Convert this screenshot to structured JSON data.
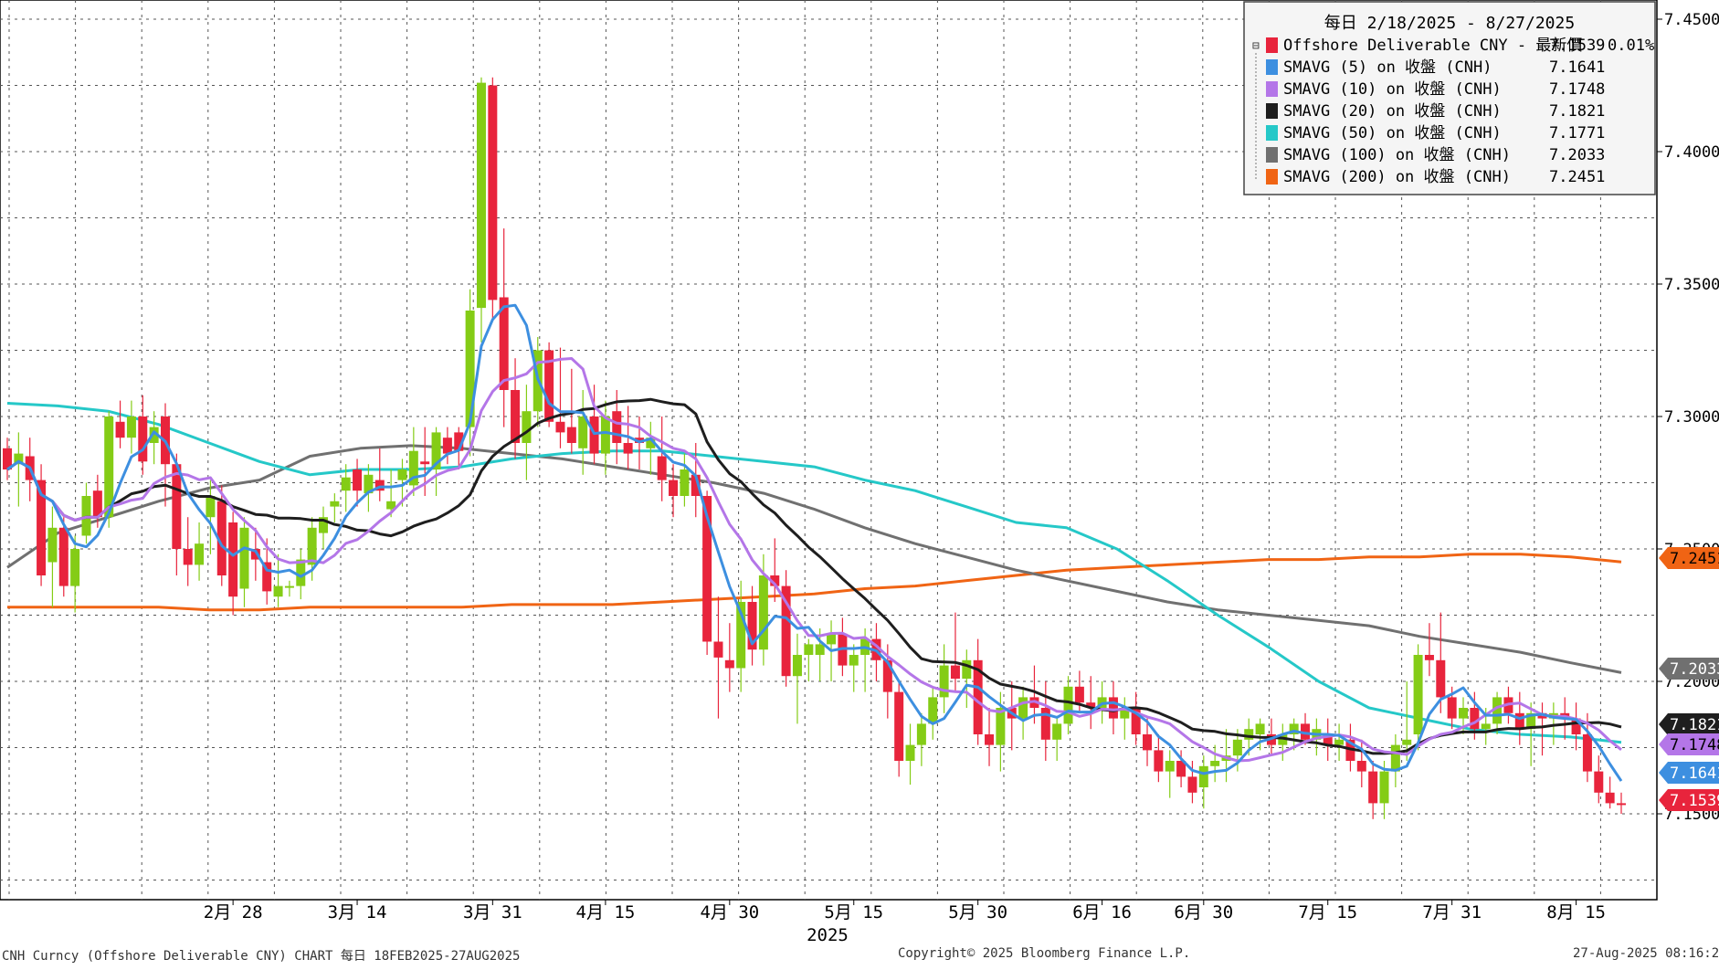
{
  "chart_data": {
    "type": "candlestick",
    "instrument": "CNH Curncy",
    "period_header": "每日 2/18/2025 - 8/27/2025",
    "ylim": [
      7.12,
      7.455
    ],
    "y_ticks": [
      "7.4500",
      "7.4000",
      "7.3500",
      "7.3000",
      "7.2500",
      "7.2000",
      "7.1500"
    ],
    "y_tick_values": [
      7.45,
      7.4,
      7.35,
      7.3,
      7.25,
      7.2,
      7.15
    ],
    "x_tick_labels": [
      "2月 28",
      "3月 14",
      "3月 31",
      "4月 15",
      "4月 30",
      "5月 15",
      "5月 30",
      "6月 16",
      "6月 30",
      "7月 15",
      "7月 31",
      "8月 15"
    ],
    "x_tick_index": [
      20,
      31,
      43,
      53,
      64,
      75,
      86,
      97,
      106,
      117,
      128,
      139
    ],
    "x_year_label": "2025",
    "grid": true,
    "legend_placement": "top-right",
    "ohlc": [
      [
        7.288,
        7.292,
        7.276,
        7.28
      ],
      [
        7.282,
        7.294,
        7.266,
        7.286
      ],
      [
        7.285,
        7.292,
        7.268,
        7.276
      ],
      [
        7.276,
        7.282,
        7.236,
        7.24
      ],
      [
        7.245,
        7.266,
        7.228,
        7.258
      ],
      [
        7.258,
        7.262,
        7.232,
        7.236
      ],
      [
        7.236,
        7.255,
        7.226,
        7.25
      ],
      [
        7.255,
        7.275,
        7.252,
        7.27
      ],
      [
        7.272,
        7.278,
        7.258,
        7.262
      ],
      [
        7.262,
        7.302,
        7.258,
        7.3
      ],
      [
        7.298,
        7.306,
        7.288,
        7.292
      ],
      [
        7.292,
        7.306,
        7.286,
        7.3
      ],
      [
        7.3,
        7.308,
        7.278,
        7.283
      ],
      [
        7.29,
        7.302,
        7.282,
        7.296
      ],
      [
        7.3,
        7.305,
        7.266,
        7.282
      ],
      [
        7.282,
        7.286,
        7.24,
        7.25
      ],
      [
        7.25,
        7.262,
        7.236,
        7.244
      ],
      [
        7.244,
        7.26,
        7.238,
        7.252
      ],
      [
        7.262,
        7.276,
        7.248,
        7.27
      ],
      [
        7.268,
        7.274,
        7.236,
        7.24
      ],
      [
        7.26,
        7.264,
        7.225,
        7.232
      ],
      [
        7.235,
        7.262,
        7.228,
        7.258
      ],
      [
        7.25,
        7.258,
        7.238,
        7.246
      ],
      [
        7.245,
        7.254,
        7.229,
        7.234
      ],
      [
        7.232,
        7.248,
        7.228,
        7.236
      ],
      [
        7.236,
        7.238,
        7.232,
        7.236
      ],
      [
        7.236,
        7.25,
        7.231,
        7.246
      ],
      [
        7.244,
        7.262,
        7.238,
        7.258
      ],
      [
        7.256,
        7.266,
        7.25,
        7.262
      ],
      [
        7.266,
        7.271,
        7.26,
        7.268
      ],
      [
        7.272,
        7.282,
        7.264,
        7.277
      ],
      [
        7.28,
        7.284,
        7.266,
        7.272
      ],
      [
        7.271,
        7.282,
        7.264,
        7.278
      ],
      [
        7.276,
        7.288,
        7.268,
        7.272
      ],
      [
        7.265,
        7.28,
        7.262,
        7.268
      ],
      [
        7.276,
        7.284,
        7.266,
        7.28
      ],
      [
        7.274,
        7.296,
        7.27,
        7.287
      ],
      [
        7.283,
        7.296,
        7.27,
        7.282
      ],
      [
        7.28,
        7.296,
        7.27,
        7.294
      ],
      [
        7.292,
        7.296,
        7.282,
        7.286
      ],
      [
        7.294,
        7.296,
        7.28,
        7.287
      ],
      [
        7.296,
        7.348,
        7.285,
        7.34
      ],
      [
        7.341,
        7.428,
        7.328,
        7.426
      ],
      [
        7.425,
        7.428,
        7.336,
        7.344
      ],
      [
        7.345,
        7.371,
        7.296,
        7.31
      ],
      [
        7.31,
        7.322,
        7.284,
        7.29
      ],
      [
        7.29,
        7.312,
        7.276,
        7.302
      ],
      [
        7.302,
        7.33,
        7.296,
        7.325
      ],
      [
        7.325,
        7.328,
        7.296,
        7.298
      ],
      [
        7.298,
        7.326,
        7.288,
        7.294
      ],
      [
        7.296,
        7.318,
        7.286,
        7.29
      ],
      [
        7.288,
        7.31,
        7.278,
        7.3
      ],
      [
        7.3,
        7.312,
        7.282,
        7.286
      ],
      [
        7.286,
        7.306,
        7.278,
        7.3
      ],
      [
        7.302,
        7.31,
        7.282,
        7.29
      ],
      [
        7.29,
        7.304,
        7.28,
        7.286
      ],
      [
        7.292,
        7.3,
        7.28,
        7.29
      ],
      [
        7.288,
        7.298,
        7.278,
        7.292
      ],
      [
        7.285,
        7.3,
        7.268,
        7.276
      ],
      [
        7.276,
        7.282,
        7.262,
        7.27
      ],
      [
        7.27,
        7.286,
        7.266,
        7.28
      ],
      [
        7.278,
        7.29,
        7.262,
        7.27
      ],
      [
        7.27,
        7.272,
        7.21,
        7.215
      ],
      [
        7.215,
        7.232,
        7.186,
        7.209
      ],
      [
        7.208,
        7.222,
        7.196,
        7.205
      ],
      [
        7.205,
        7.238,
        7.196,
        7.23
      ],
      [
        7.23,
        7.236,
        7.206,
        7.212
      ],
      [
        7.212,
        7.248,
        7.206,
        7.24
      ],
      [
        7.24,
        7.254,
        7.23,
        7.236
      ],
      [
        7.236,
        7.242,
        7.198,
        7.202
      ],
      [
        7.202,
        7.218,
        7.184,
        7.21
      ],
      [
        7.21,
        7.216,
        7.2,
        7.214
      ],
      [
        7.21,
        7.22,
        7.2,
        7.214
      ],
      [
        7.214,
        7.223,
        7.2,
        7.218
      ],
      [
        7.218,
        7.224,
        7.202,
        7.206
      ],
      [
        7.206,
        7.214,
        7.196,
        7.21
      ],
      [
        7.21,
        7.22,
        7.196,
        7.216
      ],
      [
        7.216,
        7.222,
        7.2,
        7.208
      ],
      [
        7.208,
        7.214,
        7.186,
        7.196
      ],
      [
        7.196,
        7.2,
        7.164,
        7.17
      ],
      [
        7.17,
        7.184,
        7.161,
        7.176
      ],
      [
        7.176,
        7.188,
        7.168,
        7.184
      ],
      [
        7.184,
        7.198,
        7.178,
        7.194
      ],
      [
        7.194,
        7.214,
        7.188,
        7.206
      ],
      [
        7.206,
        7.226,
        7.196,
        7.201
      ],
      [
        7.201,
        7.212,
        7.19,
        7.208
      ],
      [
        7.208,
        7.216,
        7.176,
        7.18
      ],
      [
        7.18,
        7.19,
        7.168,
        7.176
      ],
      [
        7.176,
        7.196,
        7.166,
        7.19
      ],
      [
        7.19,
        7.2,
        7.174,
        7.186
      ],
      [
        7.186,
        7.198,
        7.178,
        7.194
      ],
      [
        7.194,
        7.206,
        7.184,
        7.19
      ],
      [
        7.19,
        7.2,
        7.17,
        7.178
      ],
      [
        7.178,
        7.186,
        7.17,
        7.184
      ],
      [
        7.184,
        7.202,
        7.18,
        7.198
      ],
      [
        7.198,
        7.204,
        7.188,
        7.192
      ],
      [
        7.192,
        7.202,
        7.182,
        7.19
      ],
      [
        7.19,
        7.2,
        7.184,
        7.194
      ],
      [
        7.194,
        7.2,
        7.18,
        7.186
      ],
      [
        7.186,
        7.194,
        7.178,
        7.19
      ],
      [
        7.19,
        7.196,
        7.176,
        7.18
      ],
      [
        7.18,
        7.186,
        7.168,
        7.174
      ],
      [
        7.174,
        7.18,
        7.162,
        7.166
      ],
      [
        7.166,
        7.174,
        7.156,
        7.17
      ],
      [
        7.17,
        7.174,
        7.16,
        7.164
      ],
      [
        7.164,
        7.17,
        7.154,
        7.158
      ],
      [
        7.16,
        7.172,
        7.152,
        7.168
      ],
      [
        7.168,
        7.176,
        7.162,
        7.17
      ],
      [
        7.17,
        7.182,
        7.162,
        7.172
      ],
      [
        7.172,
        7.182,
        7.166,
        7.178
      ],
      [
        7.178,
        7.186,
        7.172,
        7.182
      ],
      [
        7.18,
        7.186,
        7.174,
        7.184
      ],
      [
        7.18,
        7.186,
        7.172,
        7.176
      ],
      [
        7.176,
        7.184,
        7.17,
        7.18
      ],
      [
        7.18,
        7.186,
        7.174,
        7.184
      ],
      [
        7.184,
        7.188,
        7.176,
        7.178
      ],
      [
        7.178,
        7.186,
        7.172,
        7.182
      ],
      [
        7.18,
        7.186,
        7.17,
        7.176
      ],
      [
        7.176,
        7.184,
        7.17,
        7.178
      ],
      [
        7.178,
        7.184,
        7.166,
        7.17
      ],
      [
        7.17,
        7.178,
        7.16,
        7.166
      ],
      [
        7.166,
        7.17,
        7.148,
        7.154
      ],
      [
        7.154,
        7.17,
        7.148,
        7.166
      ],
      [
        7.166,
        7.18,
        7.16,
        7.176
      ],
      [
        7.176,
        7.2,
        7.17,
        7.178
      ],
      [
        7.18,
        7.214,
        7.174,
        7.21
      ],
      [
        7.21,
        7.222,
        7.202,
        7.208
      ],
      [
        7.208,
        7.226,
        7.188,
        7.194
      ],
      [
        7.194,
        7.198,
        7.182,
        7.186
      ],
      [
        7.186,
        7.194,
        7.18,
        7.19
      ],
      [
        7.19,
        7.196,
        7.178,
        7.182
      ],
      [
        7.182,
        7.19,
        7.176,
        7.184
      ],
      [
        7.184,
        7.196,
        7.18,
        7.194
      ],
      [
        7.194,
        7.198,
        7.184,
        7.188
      ],
      [
        7.188,
        7.196,
        7.176,
        7.182
      ],
      [
        7.182,
        7.192,
        7.168,
        7.188
      ],
      [
        7.188,
        7.192,
        7.172,
        7.186
      ],
      [
        7.186,
        7.192,
        7.176,
        7.188
      ],
      [
        7.188,
        7.194,
        7.178,
        7.186
      ],
      [
        7.186,
        7.192,
        7.174,
        7.18
      ],
      [
        7.18,
        7.188,
        7.162,
        7.166
      ],
      [
        7.166,
        7.172,
        7.154,
        7.158
      ],
      [
        7.158,
        7.164,
        7.152,
        7.154
      ],
      [
        7.154,
        7.158,
        7.15,
        7.1539
      ]
    ],
    "series": [
      {
        "name": "Offshore Deliverable CNY - 最新價",
        "last": "7.1539",
        "change": "0.01%",
        "color": "#e8243c"
      },
      {
        "name": "SMAVG (5)  on 收盤 (CNH)",
        "last": "7.1641",
        "color": "#3d8fe0",
        "period": 5
      },
      {
        "name": "SMAVG (10)  on 收盤 (CNH)",
        "last": "7.1748",
        "color": "#b476e8",
        "period": 10
      },
      {
        "name": "SMAVG (20)  on 收盤 (CNH)",
        "last": "7.1821",
        "color": "#1e1e1e",
        "period": 20
      },
      {
        "name": "SMAVG (50)  on 收盤 (CNH)",
        "last": "7.1771",
        "color": "#25c8c8",
        "period": 50
      },
      {
        "name": "SMAVG (100)  on 收盤 (CNH)",
        "last": "7.2033",
        "color": "#707070",
        "period": 100
      },
      {
        "name": "SMAVG (200)  on 收盤 (CNH)",
        "last": "7.2451",
        "color": "#f06414",
        "period": 200
      }
    ],
    "long_ma": {
      "ma50": [
        7.305,
        7.304,
        7.302,
        7.297,
        7.29,
        7.283,
        7.278,
        7.28,
        7.28,
        7.281,
        7.284,
        7.286,
        7.287,
        7.287,
        7.285,
        7.283,
        7.281,
        7.276,
        7.272,
        7.266,
        7.26,
        7.258,
        7.25,
        7.238,
        7.225,
        7.213,
        7.2,
        7.19,
        7.186,
        7.182,
        7.18,
        7.179,
        7.177
      ],
      "ma100": [
        7.243,
        7.256,
        7.262,
        7.268,
        7.273,
        7.276,
        7.285,
        7.288,
        7.289,
        7.288,
        7.286,
        7.284,
        7.281,
        7.278,
        7.275,
        7.271,
        7.265,
        7.258,
        7.252,
        7.247,
        7.242,
        7.238,
        7.234,
        7.23,
        7.227,
        7.225,
        7.223,
        7.221,
        7.217,
        7.214,
        7.211,
        7.207,
        7.2033
      ],
      "ma200": [
        7.228,
        7.228,
        7.228,
        7.228,
        7.227,
        7.227,
        7.228,
        7.228,
        7.228,
        7.228,
        7.229,
        7.229,
        7.229,
        7.23,
        7.231,
        7.232,
        7.233,
        7.235,
        7.236,
        7.238,
        7.24,
        7.242,
        7.243,
        7.244,
        7.245,
        7.246,
        7.246,
        7.247,
        7.247,
        7.248,
        7.248,
        7.247,
        7.2451
      ]
    }
  },
  "footer": {
    "left": "CNH Curncy (Offshore Deliverable CNY) CHART  每日 18FEB2025-27AUG2025",
    "center": "Copyright© 2025 Bloomberg Finance L.P.",
    "right": "27-Aug-2025 08:16:28"
  }
}
